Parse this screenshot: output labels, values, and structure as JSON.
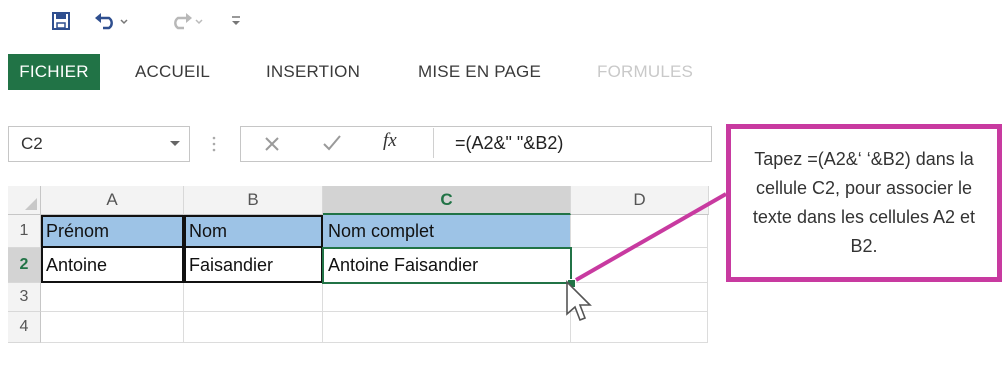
{
  "tabs": [
    "FICHIER",
    "ACCUEIL",
    "INSERTION",
    "MISE EN PAGE",
    "FORMULES"
  ],
  "name_box": {
    "value": "C2"
  },
  "formula_bar": {
    "cancel_icon": "close-icon",
    "enter_icon": "checkmark-icon",
    "function_label": "fx",
    "formula": "=(A2&\" \"&B2)"
  },
  "columns": [
    "A",
    "B",
    "C",
    "D"
  ],
  "rows": [
    "1",
    "2",
    "3",
    "4"
  ],
  "cells": {
    "A1": "Prénom",
    "B1": "Nom",
    "C1": "Nom complet",
    "A2": "Antoine",
    "B2": "Faisandier",
    "C2": "Antoine Faisandier"
  },
  "callout": {
    "text": "Tapez =(A2&‘ ‘&B2) dans la cellule C2, pour associer le texte dans les cellules A2 et B2."
  },
  "colors": {
    "accent": "#217346",
    "header_fill": "#9dc3e6",
    "callout_border": "#c83aa0"
  }
}
